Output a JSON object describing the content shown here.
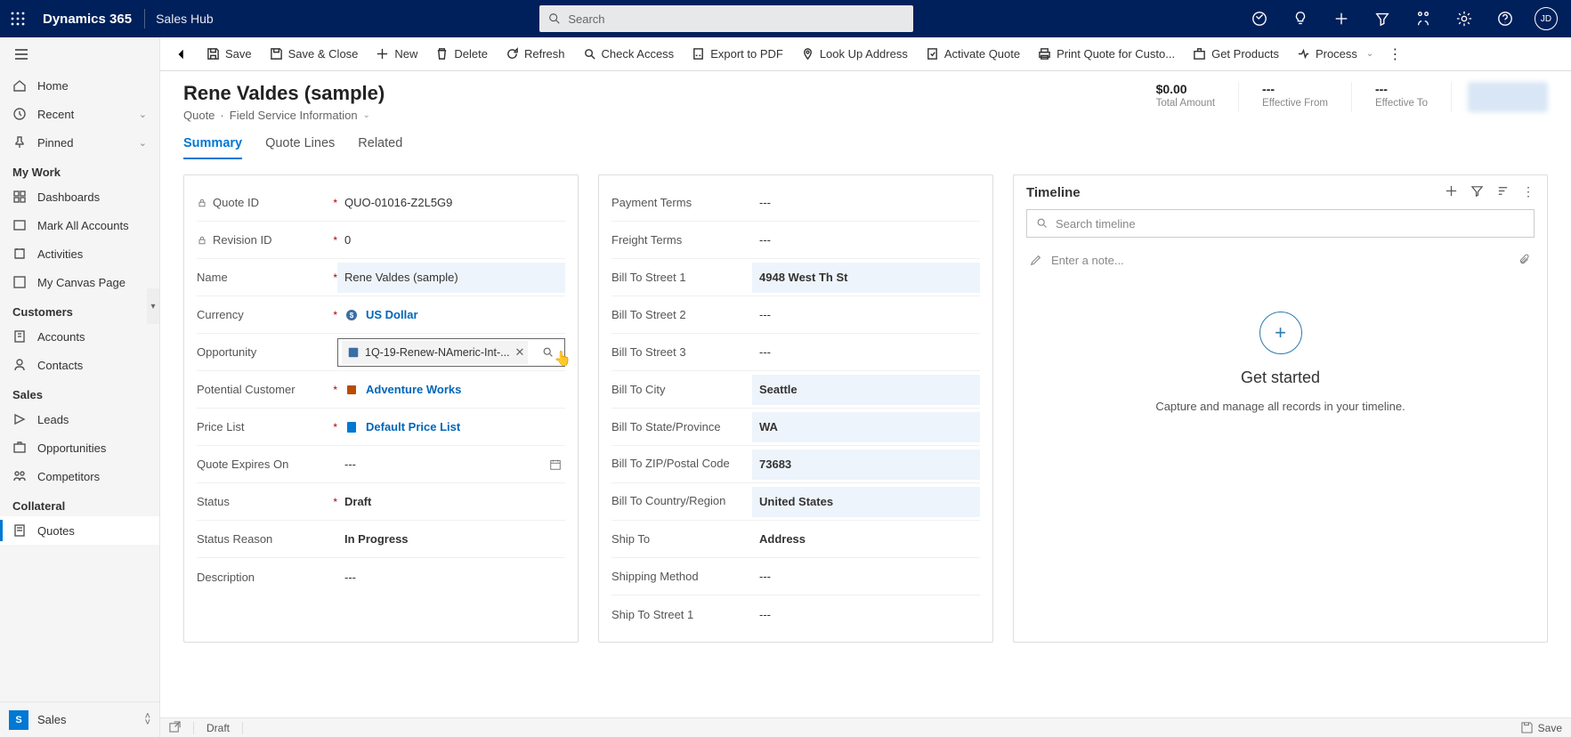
{
  "header": {
    "brand": "Dynamics 365",
    "hub": "Sales Hub",
    "search_placeholder": "Search",
    "avatar_initials": "JD"
  },
  "cmdbar": {
    "save": "Save",
    "save_close": "Save & Close",
    "new": "New",
    "delete": "Delete",
    "refresh": "Refresh",
    "check_access": "Check Access",
    "export_pdf": "Export to PDF",
    "look_up_address": "Look Up Address",
    "activate_quote": "Activate Quote",
    "print_quote": "Print Quote for Custo...",
    "get_products": "Get Products",
    "process": "Process"
  },
  "nav": {
    "home": "Home",
    "recent": "Recent",
    "pinned": "Pinned",
    "group_mywork": "My Work",
    "dashboards": "Dashboards",
    "mark_all": "Mark All Accounts",
    "activities": "Activities",
    "my_canvas": "My Canvas Page",
    "group_customers": "Customers",
    "accounts": "Accounts",
    "contacts": "Contacts",
    "group_sales": "Sales",
    "leads": "Leads",
    "opportunities": "Opportunities",
    "competitors": "Competitors",
    "group_collateral": "Collateral",
    "quotes": "Quotes",
    "area_badge": "S",
    "area_label": "Sales"
  },
  "record": {
    "title": "Rene Valdes (sample)",
    "subtitle_entity": "Quote",
    "subtitle_form": "Field Service Information",
    "total_amount": "$0.00",
    "total_amount_label": "Total Amount",
    "eff_from": "---",
    "eff_from_label": "Effective From",
    "eff_to": "---",
    "eff_to_label": "Effective To"
  },
  "tabs": {
    "summary": "Summary",
    "quote_lines": "Quote Lines",
    "related": "Related"
  },
  "left": {
    "quote_id_label": "Quote ID",
    "quote_id_value": "QUO-01016-Z2L5G9",
    "revision_id_label": "Revision ID",
    "revision_id_value": "0",
    "name_label": "Name",
    "name_value": "Rene Valdes (sample)",
    "currency_label": "Currency",
    "currency_value": "US Dollar",
    "opportunity_label": "Opportunity",
    "opportunity_chip": "1Q-19-Renew-NAmeric-Int-...",
    "potential_customer_label": "Potential Customer",
    "potential_customer_value": "Adventure Works",
    "price_list_label": "Price List",
    "price_list_value": "Default Price List",
    "quote_expires_label": "Quote Expires On",
    "quote_expires_value": "---",
    "status_label": "Status",
    "status_value": "Draft",
    "status_reason_label": "Status Reason",
    "status_reason_value": "In Progress",
    "description_label": "Description",
    "description_value": "---"
  },
  "right": {
    "payment_terms_label": "Payment Terms",
    "payment_terms_value": "---",
    "freight_terms_label": "Freight Terms",
    "freight_terms_value": "---",
    "bill_street1_label": "Bill To Street 1",
    "bill_street1_value": "4948 West Th St",
    "bill_street2_label": "Bill To Street 2",
    "bill_street2_value": "---",
    "bill_street3_label": "Bill To Street 3",
    "bill_street3_value": "---",
    "bill_city_label": "Bill To City",
    "bill_city_value": "Seattle",
    "bill_state_label": "Bill To State/Province",
    "bill_state_value": "WA",
    "bill_zip_label": "Bill To ZIP/Postal Code",
    "bill_zip_value": "73683",
    "bill_country_label": "Bill To Country/Region",
    "bill_country_value": "United States",
    "ship_to_label": "Ship To",
    "ship_to_value": "Address",
    "shipping_method_label": "Shipping Method",
    "shipping_method_value": "---",
    "ship_street1_label": "Ship To Street 1",
    "ship_street1_value": "---"
  },
  "timeline": {
    "title": "Timeline",
    "search_placeholder": "Search timeline",
    "note_placeholder": "Enter a note...",
    "empty_title": "Get started",
    "empty_desc": "Capture and manage all records in your timeline."
  },
  "footer": {
    "status": "Draft",
    "save": "Save"
  }
}
